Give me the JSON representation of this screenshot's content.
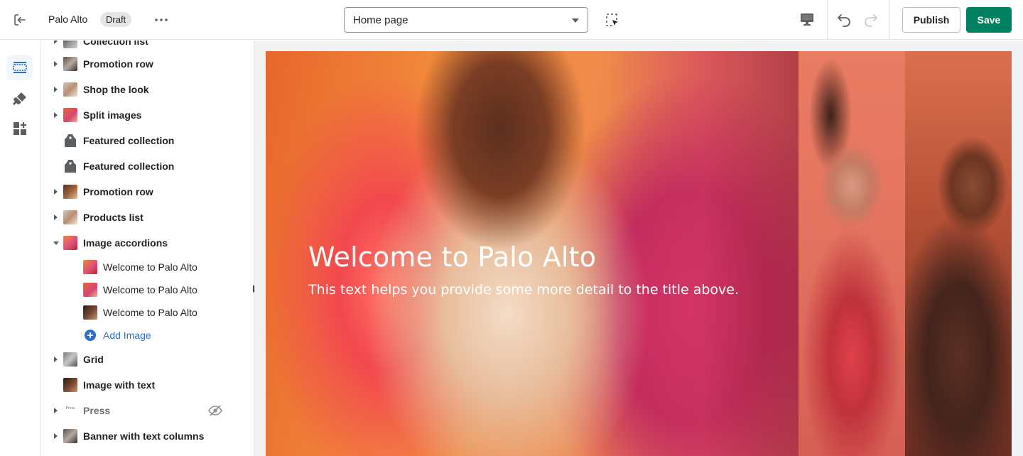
{
  "topbar": {
    "store_name": "Palo Alto",
    "status_badge": "Draft",
    "page_select": "Home page",
    "publish_label": "Publish",
    "save_label": "Save",
    "icons": [
      "exit-icon",
      "more-icon",
      "inspector-icon",
      "desktop-view-icon",
      "undo-icon",
      "redo-icon"
    ]
  },
  "rail": {
    "items": [
      {
        "name": "sections",
        "icon": "sections-icon",
        "active": true
      },
      {
        "name": "theme-settings",
        "icon": "paint-brush-icon",
        "active": false
      },
      {
        "name": "app-embeds",
        "icon": "apps-icon",
        "active": false
      }
    ]
  },
  "sidebar": {
    "sections": [
      {
        "label": "Collection list",
        "expandable": true
      },
      {
        "label": "Promotion row",
        "expandable": true
      },
      {
        "label": "Shop the look",
        "expandable": true
      },
      {
        "label": "Split images",
        "expandable": true
      },
      {
        "label": "Featured collection",
        "expandable": false
      },
      {
        "label": "Featured collection",
        "expandable": false
      },
      {
        "label": "Promotion row",
        "expandable": true
      },
      {
        "label": "Products list",
        "expandable": true
      },
      {
        "label": "Image accordions",
        "expandable": true,
        "expanded": true
      },
      {
        "label": "Grid",
        "expandable": true
      },
      {
        "label": "Image with text",
        "expandable": false
      },
      {
        "label": "Press",
        "expandable": true,
        "hidden": true
      },
      {
        "label": "Banner with text columns",
        "expandable": true
      }
    ],
    "accordion_children": [
      {
        "label": "Welcome to Palo Alto"
      },
      {
        "label": "Welcome to Palo Alto"
      },
      {
        "label": "Welcome to Palo Alto"
      }
    ],
    "add_image_label": "Add Image",
    "press_thumb_text": "Press"
  },
  "preview": {
    "hero_title": "Welcome to Palo Alto",
    "hero_subtitle": "This text helps you provide some more detail to the title above.",
    "accent_colors": {
      "save": "#008060",
      "link": "#2c6ecb",
      "rail_active": "#f2f7fe"
    }
  }
}
